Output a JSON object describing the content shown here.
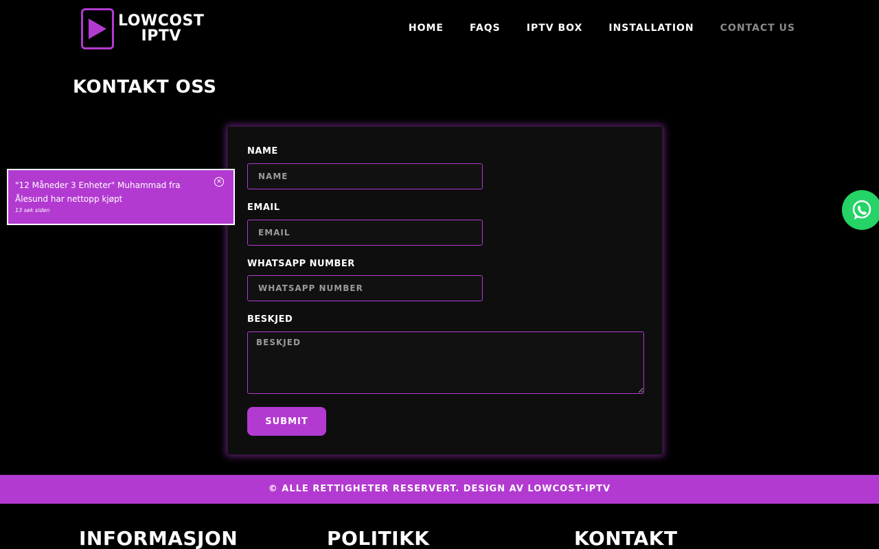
{
  "brand": {
    "line1": "LOWCOST",
    "line2": "IPTV",
    "accent_color": "#b33ad1"
  },
  "nav": {
    "items": [
      {
        "label": "HOME"
      },
      {
        "label": "FAQS"
      },
      {
        "label": "IPTV BOX"
      },
      {
        "label": "INSTALLATION"
      },
      {
        "label": "CONTACT US"
      }
    ],
    "active": "CONTACT US"
  },
  "page": {
    "title": "KONTAKT OSS"
  },
  "form": {
    "name_label": "NAME",
    "name_placeholder": "NAME",
    "email_label": "EMAIL",
    "email_placeholder": "EMAIL",
    "whatsapp_label": "WHATSAPP NUMBER",
    "whatsapp_placeholder": "WHATSAPP NUMBER",
    "message_label": "BESKJED",
    "message_placeholder": "BESKJED",
    "submit_label": "SUBMIT"
  },
  "toast": {
    "message": "\"12 Måneder 3 Enheter\" Muhammad fra Ålesund har nettopp kjøpt",
    "time": "13 sek siden",
    "close_icon": "close-circle-icon"
  },
  "whatsapp": {
    "icon": "whatsapp-icon",
    "color": "#25d366"
  },
  "footer": {
    "copyright": "© ALLE RETTIGHETER RESERVERT. DESIGN AV LOWCOST-IPTV",
    "headings": [
      "INFORMASJON",
      "POLITIKK",
      "KONTAKT"
    ]
  }
}
